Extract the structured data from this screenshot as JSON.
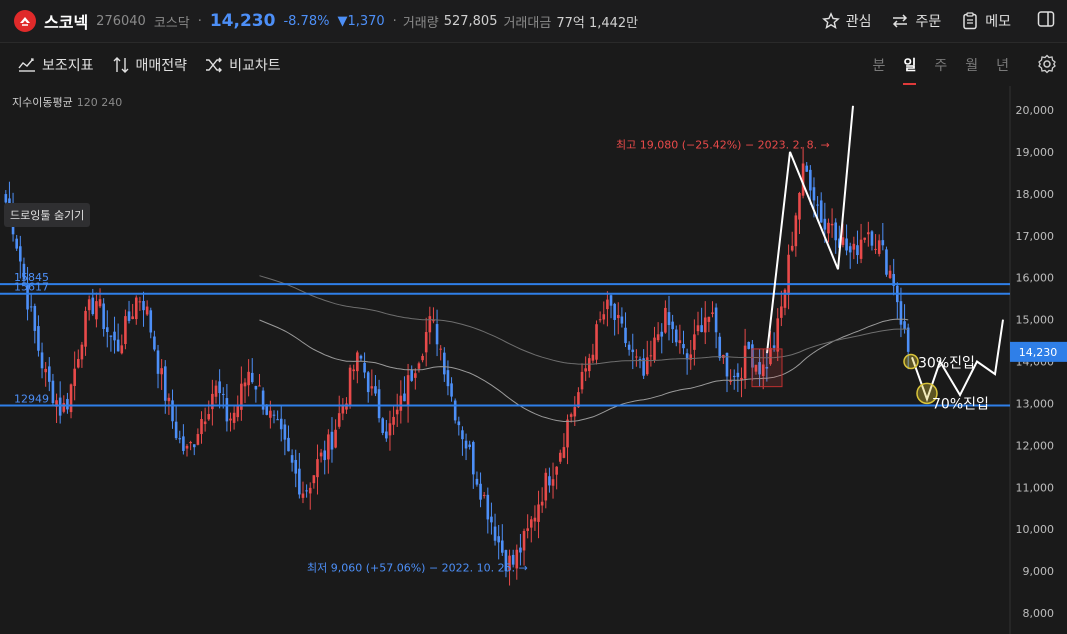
{
  "header": {
    "name": "스코넥",
    "code": "276040",
    "market": "코스닥",
    "price": "14,230",
    "rate": "-8.78%",
    "change": "▼1,370",
    "volume_label": "거래량",
    "volume": "527,805",
    "amount_label": "거래대금",
    "amount": "77억 1,442만",
    "actions": {
      "watch": "관심",
      "order": "주문",
      "memo": "메모"
    }
  },
  "toolbar": {
    "indicator": "보조지표",
    "strategy": "매매전략",
    "compare": "비교차트",
    "periods": [
      "분",
      "일",
      "주",
      "월",
      "년"
    ],
    "active_period": "일"
  },
  "legend": {
    "ma_label": "지수이동평균",
    "ma_periods": "120 240"
  },
  "hide_drawing": "드로잉툴 숨기기",
  "colors": {
    "up": "#e84a4a",
    "down": "#4d8ff7",
    "hline": "#2f7fe8",
    "bg": "#1a1a1a",
    "drawing": "#ffffff",
    "highlight": "#d9c43a"
  },
  "chart_data": {
    "type": "candlestick",
    "ylim": [
      8000,
      20000
    ],
    "y_ticks": [
      "20,000",
      "19,000",
      "18,000",
      "17,000",
      "16,000",
      "15,000",
      "14,000",
      "13,000",
      "12,000",
      "11,000",
      "10,000",
      "9,000",
      "8,000"
    ],
    "current_price": 14230,
    "current_price_label": "14,230",
    "horizontal_lines": [
      {
        "value": 15845,
        "label": "15845"
      },
      {
        "value": 15617,
        "label": "15617"
      },
      {
        "value": 12949,
        "label": "12949"
      }
    ],
    "annotations": {
      "high": "최고 19,080 (−25.42%) − 2023. 2. 8. →",
      "low": "최저 9,060 (+57.06%) − 2022. 10. 25. →",
      "entry30": "30%진입",
      "entry70": "70%진입"
    },
    "price_path": [
      17800,
      17300,
      16500,
      15600,
      14800,
      14100,
      13500,
      13200,
      12800,
      13100,
      13900,
      14700,
      15200,
      15500,
      15000,
      14600,
      14300,
      14700,
      15100,
      15600,
      15400,
      14700,
      13900,
      13200,
      12600,
      12100,
      11800,
      12100,
      12600,
      12900,
      13400,
      13100,
      12600,
      12800,
      13300,
      13800,
      13500,
      13100,
      12700,
      12400,
      12000,
      11600,
      11200,
      10900,
      11200,
      11600,
      11800,
      12200,
      12700,
      13200,
      13800,
      14100,
      13600,
      13100,
      12700,
      12300,
      12600,
      13000,
      13500,
      14000,
      14400,
      14900,
      14700,
      14100,
      13300,
      12700,
      12200,
      11700,
      11200,
      10700,
      10200,
      9700,
      9300,
      9150,
      9500,
      9800,
      10300,
      10800,
      11200,
      11500,
      12000,
      12600,
      13000,
      13500,
      14100,
      14600,
      15100,
      15300,
      14900,
      14600,
      14200,
      13900,
      13600,
      14100,
      14700,
      15000,
      14700,
      14400,
      14000,
      14300,
      14900,
      15200,
      14800,
      14200,
      13800,
      13600,
      13900,
      14300,
      14000,
      13800,
      14100,
      14600,
      15500,
      16600,
      17800,
      18600,
      18300,
      17700,
      17200,
      17400,
      17000,
      16700,
      16500,
      16900,
      17200,
      17000,
      16700,
      16300,
      15900,
      15000,
      14230
    ]
  }
}
